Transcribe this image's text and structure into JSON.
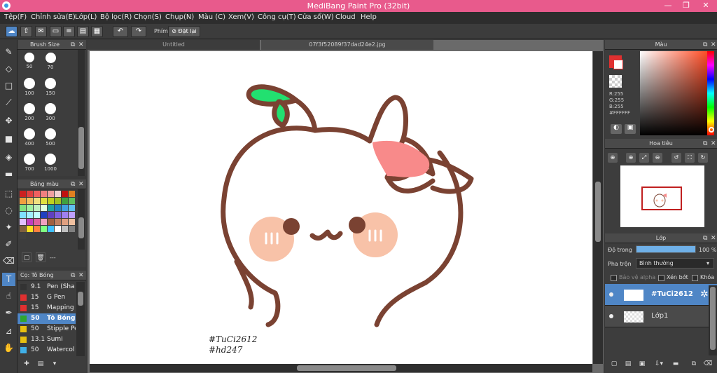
{
  "window": {
    "title": "MediBang Paint Pro (32bit)",
    "min": "—",
    "restore": "❐",
    "close": "✕"
  },
  "menu": [
    "Tệp(F)",
    "Chỉnh sửa(E)",
    "Lớp(L)",
    "Bộ lọc(R)",
    "Chọn(S)",
    "Chụp(N)",
    "Màu (C)",
    "Xem(V)",
    "Công cụ(T)",
    "Cửa sổ(W)",
    "Cloud",
    "Help"
  ],
  "toolbar": {
    "shortcut_label": "Phím",
    "reset_label": "Đặt lại"
  },
  "brush_size_panel": {
    "title": "Brush Size",
    "sizes": [
      "50",
      "70",
      "100",
      "150",
      "200",
      "300",
      "400",
      "500",
      "700",
      "1000"
    ]
  },
  "palette_panel": {
    "title": "Bảng màu",
    "more": "---"
  },
  "brush_panel": {
    "title": "Cọ: Tô Bóng",
    "brushes": [
      {
        "size": "9.1",
        "name": "Pen (Sha",
        "color": "#333333"
      },
      {
        "size": "15",
        "name": "G Pen",
        "color": "#e03030"
      },
      {
        "size": "15",
        "name": "Mapping I",
        "color": "#e03030"
      },
      {
        "size": "50",
        "name": "Tô Bóng",
        "color": "#2fa52f"
      },
      {
        "size": "50",
        "name": "Stipple Pe",
        "color": "#e8c010"
      },
      {
        "size": "13.1",
        "name": "Sumi",
        "color": "#e8c010"
      },
      {
        "size": "50",
        "name": "Watercol",
        "color": "#40b0e8"
      }
    ]
  },
  "tabs": [
    "Untitled",
    "07f3f52089f37dad24e2.jpg"
  ],
  "canvas": {
    "watermark": [
      "#TuCi2612",
      "#hd247"
    ]
  },
  "color_panel": {
    "title": "Màu",
    "r": "R:255",
    "g": "G:255",
    "b": "B:255",
    "hex": "#FFFFFF"
  },
  "navigator": {
    "title": "Hoa tiêu"
  },
  "layer_panel": {
    "title": "Lớp",
    "opacity_label": "Độ trong",
    "opacity_value": "100 %",
    "opacity": 1.0,
    "blend_label": "Pha trộn",
    "blend_value": "Bình thường",
    "protect_alpha": "Bảo vệ alpha",
    "clipping": "Xén bớt",
    "lock": "Khóa",
    "layers": [
      {
        "name": "#TuCi2612",
        "selected": true
      },
      {
        "name": "Lớp1",
        "selected": false
      }
    ]
  },
  "colors": {
    "accent": "#4f86c6",
    "titlebar": "#e85a8c",
    "outline": "#7a4232",
    "leaf": "#22e070",
    "blush": "#f8c2a8",
    "bow": "#f88a8a"
  }
}
